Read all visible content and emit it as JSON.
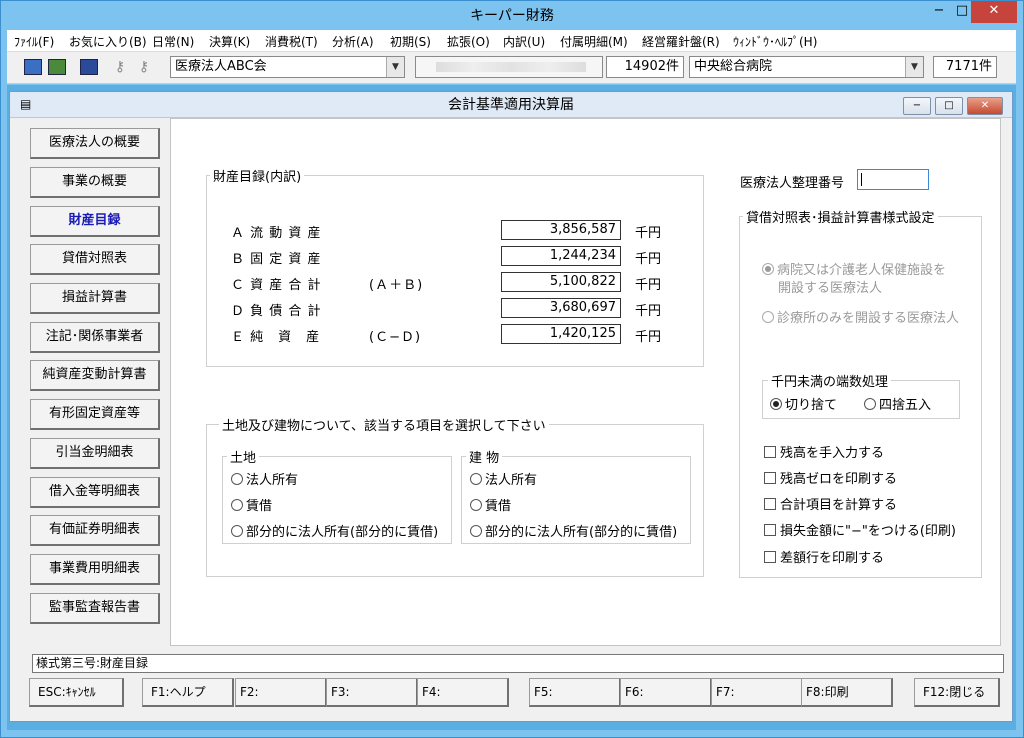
{
  "app": {
    "title": "キーパー財務",
    "minimize": "−",
    "maximize": "□",
    "close": "✕"
  },
  "menu": [
    "ﾌｧｲﾙ(F)",
    "お気に入り(B)",
    "日常(N)",
    "決算(K)",
    "消費税(T)",
    "分析(A)",
    "初期(S)",
    "拡張(O)",
    "内訳(U)",
    "付属明細(M)",
    "経営羅針盤(R)",
    "ｳｨﾝﾄﾞｳ･ﾍﾙﾌﾟ(H)"
  ],
  "toolbar": {
    "company": "医療法人ABC会",
    "company_id_masked": "",
    "count1": "14902件",
    "hospital": "中央総合病院",
    "count2": "7171件"
  },
  "child": {
    "title": "会計基準適用決算届",
    "min": "−",
    "max": "□",
    "close": "✕"
  },
  "sidebar": [
    {
      "label": "医療法人の概要"
    },
    {
      "label": "事業の概要"
    },
    {
      "label": "財産目録",
      "active": true
    },
    {
      "label": "貸借対照表"
    },
    {
      "label": "損益計算書"
    },
    {
      "label": "注記･関係事業者"
    },
    {
      "label": "純資産変動計算書"
    },
    {
      "label": "有形固定資産等"
    },
    {
      "label": "引当金明細表"
    },
    {
      "label": "借入金等明細表"
    },
    {
      "label": "有価証券明細表"
    },
    {
      "label": "事業費用明細表"
    },
    {
      "label": "監事監査報告書"
    }
  ],
  "inventory": {
    "title": "財産目録(内訳)",
    "unit": "千円",
    "rows": [
      {
        "label": "Ａ 流 動 資 産",
        "formula": "",
        "value": "3,856,587"
      },
      {
        "label": "Ｂ 固 定 資 産",
        "formula": "",
        "value": "1,244,234"
      },
      {
        "label": "Ｃ 資 産 合 計",
        "formula": "(Ａ＋Ｂ)",
        "value": "5,100,822"
      },
      {
        "label": "Ｄ 負 債 合 計",
        "formula": "",
        "value": "3,680,697"
      },
      {
        "label": "Ｅ 純　資　産",
        "formula": "(Ｃ−Ｄ)",
        "value": "1,420,125"
      }
    ]
  },
  "landbuilding": {
    "title": "土地及び建物について、該当する項目を選択して下さい",
    "land": {
      "title": "土地",
      "options": [
        "法人所有",
        "賃借",
        "部分的に法人所有(部分的に賃借)"
      ]
    },
    "building": {
      "title": "建 物",
      "options": [
        "法人所有",
        "賃借",
        "部分的に法人所有(部分的に賃借)"
      ]
    }
  },
  "corp_number": {
    "label": "医療法人整理番号",
    "value": ""
  },
  "format": {
    "title": "貸借対照表･損益計算書様式設定",
    "opt1": "病院又は介護老人保健施設を",
    "opt1b": "開設する医療法人",
    "opt2": "診療所のみを開設する医療法人"
  },
  "rounding": {
    "title": "千円未満の端数処理",
    "opt1": "切り捨て",
    "opt2": "四捨五入"
  },
  "checks": [
    "残高を手入力する",
    "残高ゼロを印刷する",
    "合計項目を計算する",
    "損失金額に\"−\"をつける(印刷)",
    "差額行を印刷する"
  ],
  "status": "様式第三号:財産目録",
  "fkeys": [
    "ESC:ｷｬﾝｾﾙ",
    "F1:ヘルプ",
    "F2:",
    "F3:",
    "F4:",
    "F5:",
    "F6:",
    "F7:",
    "F8:印刷",
    "F12:閉じる"
  ]
}
